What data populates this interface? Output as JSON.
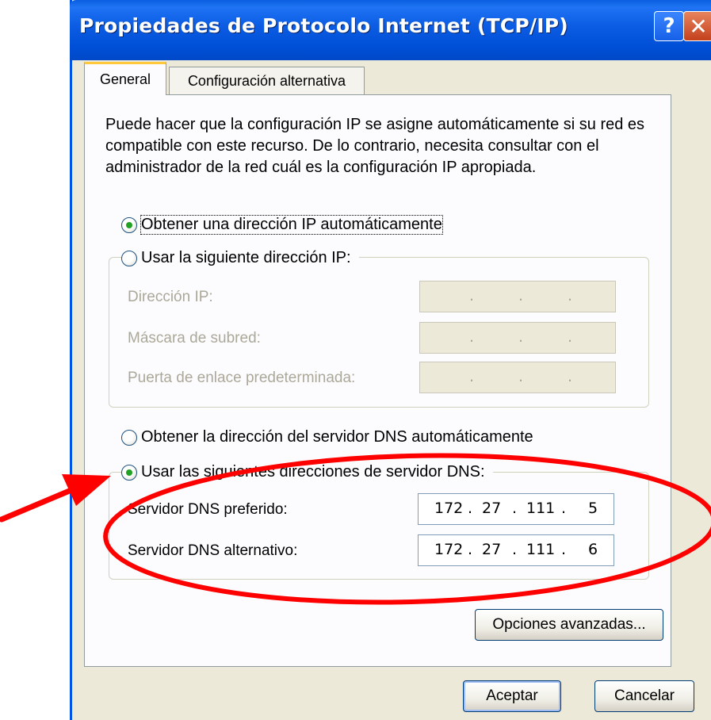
{
  "window": {
    "title": "Propiedades de Protocolo Internet (TCP/IP)",
    "help_label": "?",
    "close_label": "✕"
  },
  "tabs": [
    {
      "label": "General",
      "active": true
    },
    {
      "label": "Configuración alternativa",
      "active": false
    }
  ],
  "intro_text": "Puede hacer que la configuración IP se asigne automáticamente si su red es compatible con este recurso. De lo contrario, necesita consultar con el administrador de la red cuál es la configuración IP apropiada.",
  "ip_section": {
    "auto_label": "Obtener una dirección IP automáticamente",
    "auto_checked": true,
    "manual_label": "Usar la siguiente dirección IP:",
    "manual_checked": false,
    "fields": [
      {
        "label": "Dirección IP:",
        "value": ". . ."
      },
      {
        "label": "Máscara de subred:",
        "value": ". . ."
      },
      {
        "label": "Puerta de enlace predeterminada:",
        "value": ". . ."
      }
    ]
  },
  "dns_section": {
    "auto_label": "Obtener la dirección del servidor DNS automáticamente",
    "auto_checked": false,
    "manual_label": "Usar las siguientes direcciones de servidor DNS:",
    "manual_checked": true,
    "preferred": {
      "label": "Servidor DNS preferido:",
      "octets": [
        "172",
        "27",
        "111",
        "5"
      ]
    },
    "alternate": {
      "label": "Servidor DNS alternativo:",
      "octets": [
        "172",
        "27",
        "111",
        "6"
      ]
    }
  },
  "buttons": {
    "advanced": "Opciones avanzadas...",
    "ok": "Aceptar",
    "cancel": "Cancelar"
  },
  "annotation": {
    "color": "#ff0000"
  }
}
